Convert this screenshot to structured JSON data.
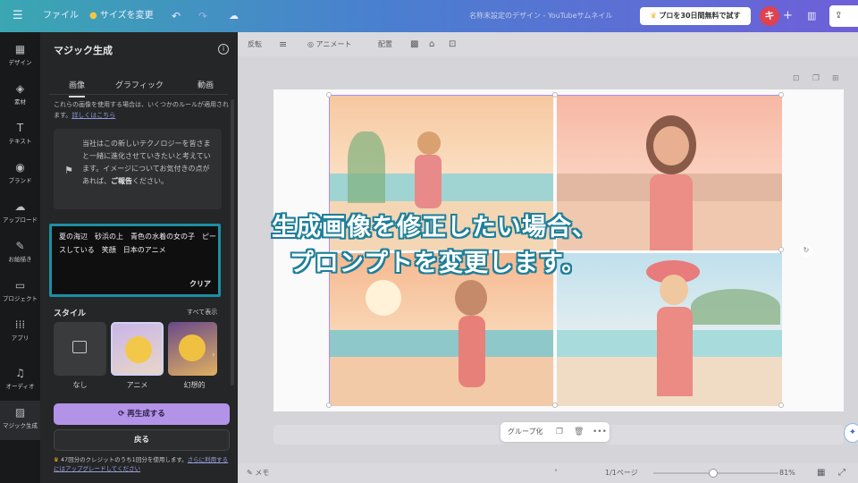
{
  "topbar": {
    "menu_icon": "hamburger-icon",
    "file_label": "ファイル",
    "resize_label": "サイズを変更",
    "doc_title": "名称未設定のデザイン - YouTubeサムネイル",
    "pro_trial_label": "プロを30日間無料で試す",
    "avatar_initial": "キ",
    "add_label": "+"
  },
  "rail": {
    "items": [
      {
        "label": "デザイン",
        "icon": "design-icon"
      },
      {
        "label": "素材",
        "icon": "elements-icon"
      },
      {
        "label": "テキスト",
        "icon": "text-icon"
      },
      {
        "label": "ブランド",
        "icon": "brand-icon"
      },
      {
        "label": "アップロード",
        "icon": "upload-icon"
      },
      {
        "label": "お絵描き",
        "icon": "draw-icon"
      },
      {
        "label": "プロジェクト",
        "icon": "folder-icon"
      },
      {
        "label": "アプリ",
        "icon": "apps-icon"
      },
      {
        "label": "オーディオ",
        "icon": "audio-icon"
      },
      {
        "label": "マジック生成",
        "icon": "magic-media-icon"
      }
    ]
  },
  "panel": {
    "title": "マジック生成",
    "tabs": [
      "画像",
      "グラフィック",
      "動画"
    ],
    "notice_text": "これらの画像を使用する場合は、いくつかのルールが適用されます。",
    "notice_link": "詳しくはこちら",
    "feedback_text": "当社はこの新しいテクノロジーを皆さまと一緒に進化させていきたいと考えています。イメージについてお気付きの点があれば、",
    "feedback_link": "ご報告",
    "feedback_tail": "ください。",
    "prompt_text": "夏の海辺　砂浜の上　青色の水着の女の子　ピースしている　笑顔　日本のアニメ",
    "clear_label": "クリア",
    "style_label": "スタイル",
    "show_all_label": "すべて表示",
    "styles": [
      "なし",
      "アニメ",
      "幻想的"
    ],
    "regenerate_label": "再生成する",
    "back_label": "戻る",
    "credit_text": "47回分のクレジットのうち1回分を使用します。",
    "credit_link": "さらに利用するにはアップグレードしてください"
  },
  "toolbar": {
    "items": [
      "反転",
      "アニメート",
      "配置"
    ]
  },
  "context_menu": {
    "group_label": "グループ化"
  },
  "bottombar": {
    "notes_label": "メモ",
    "page_label": "1/1ページ",
    "zoom_label": "81%"
  },
  "caption": {
    "line1": "生成画像を修正したい場合、",
    "line2": "プロンプトを変更します。"
  }
}
